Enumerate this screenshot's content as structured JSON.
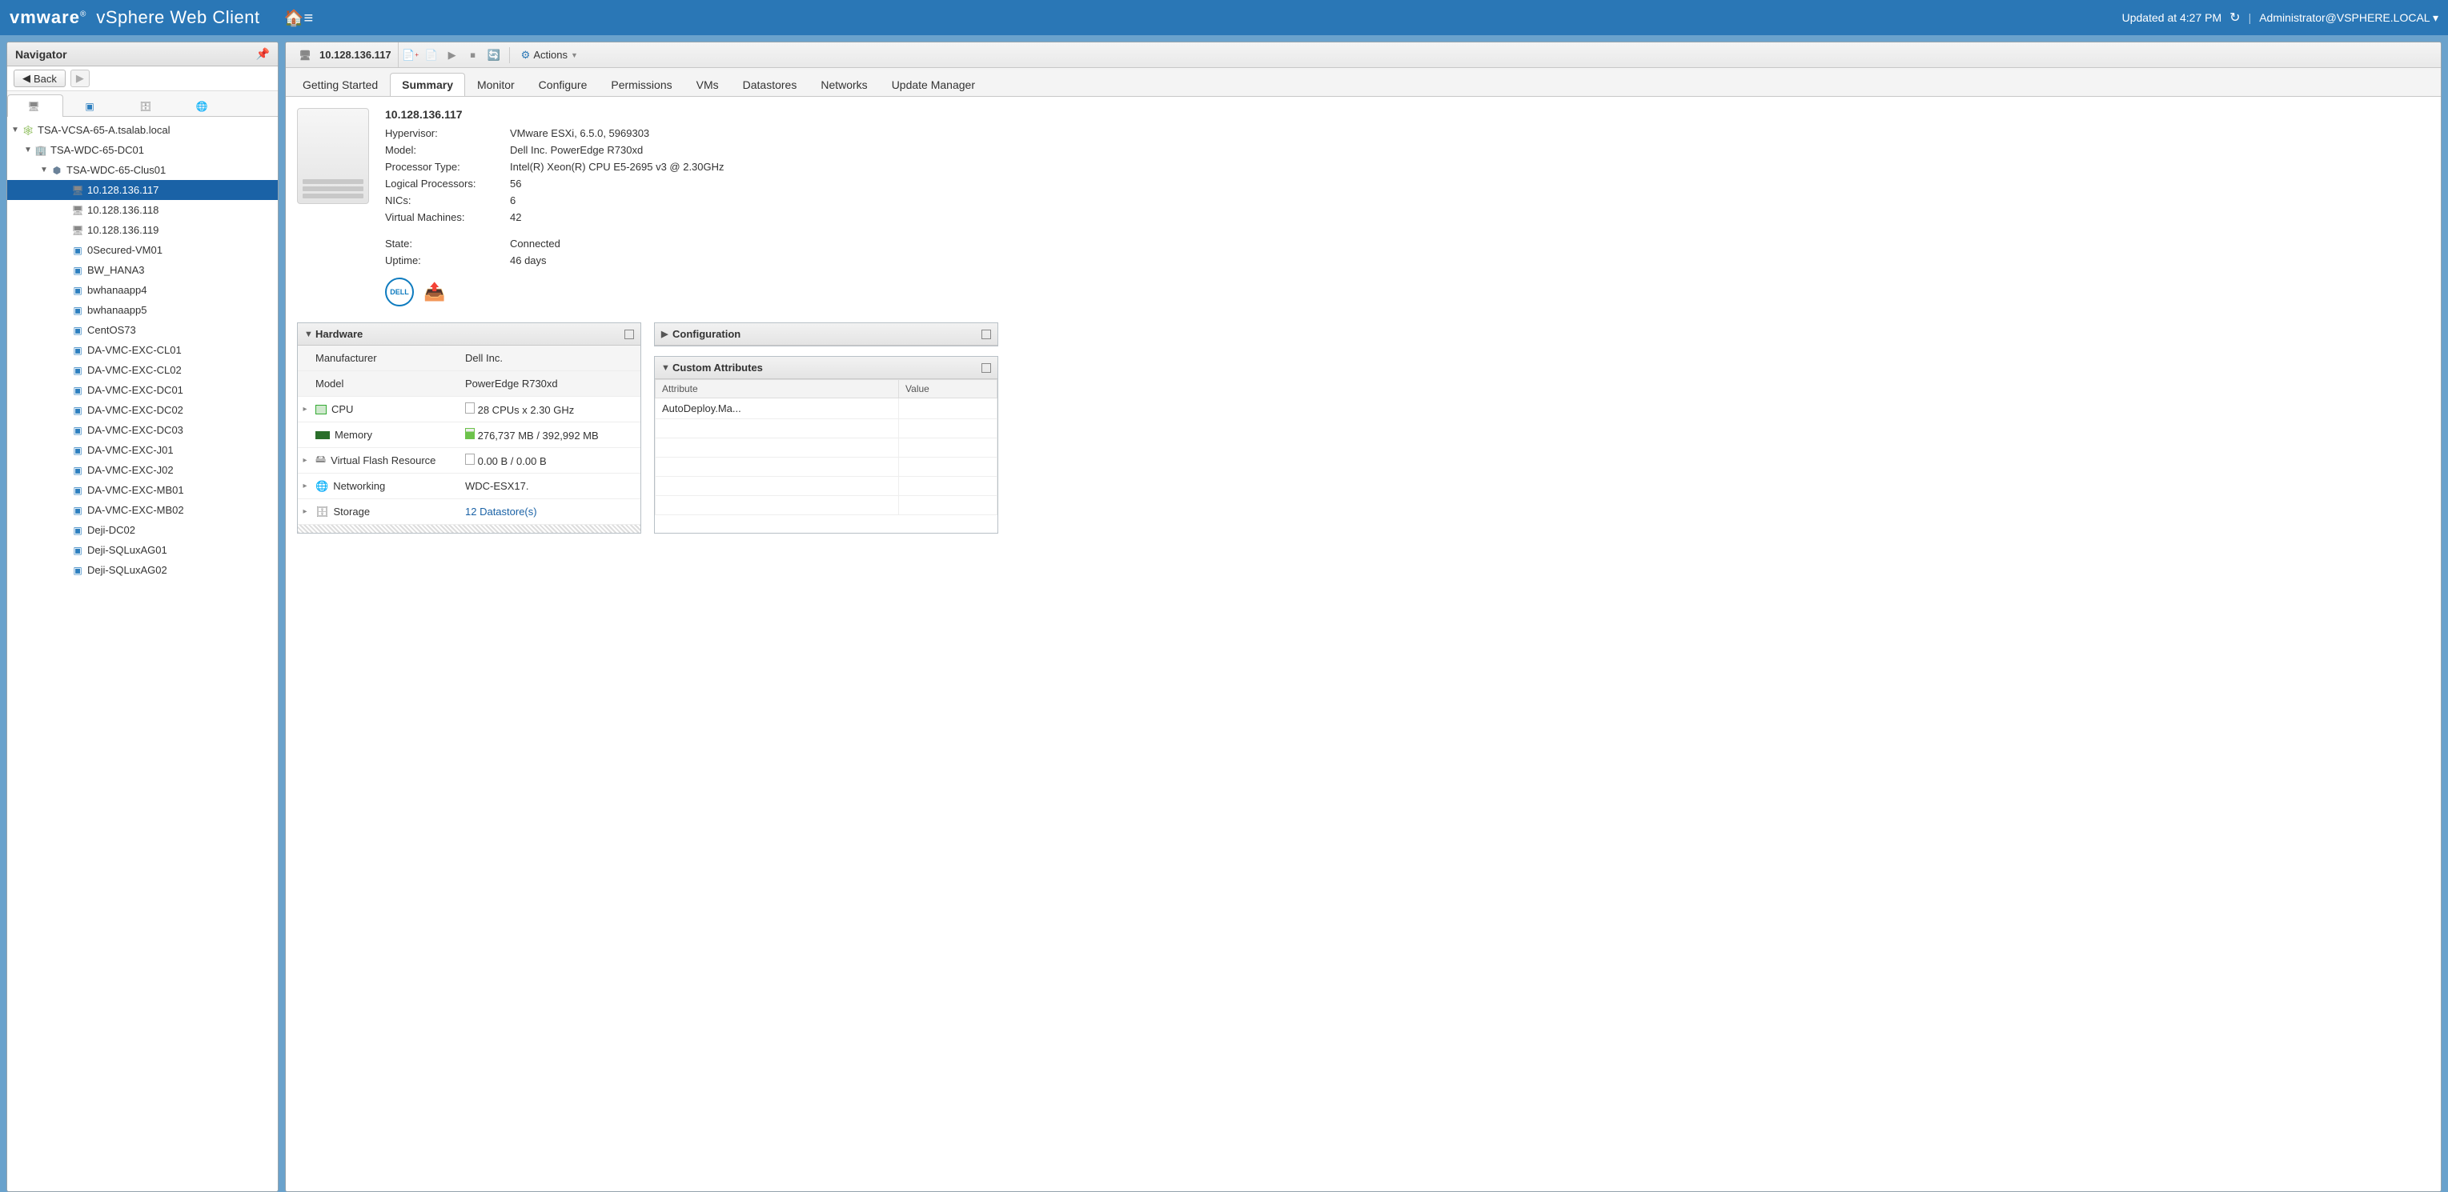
{
  "banner": {
    "brand": "vmware",
    "product": "vSphere Web Client",
    "updated": "Updated at 4:27 PM",
    "user": "Administrator@VSPHERE.LOCAL"
  },
  "navigator": {
    "title": "Navigator",
    "back": "Back",
    "tree": {
      "vcenter": "TSA-VCSA-65-A.tsalab.local",
      "datacenter": "TSA-WDC-65-DC01",
      "cluster": "TSA-WDC-65-Clus01",
      "hosts": [
        "10.128.136.117",
        "10.128.136.118",
        "10.128.136.119"
      ],
      "vms": [
        "0Secured-VM01",
        "BW_HANA3",
        "bwhanaapp4",
        "bwhanaapp5",
        "CentOS73",
        "DA-VMC-EXC-CL01",
        "DA-VMC-EXC-CL02",
        "DA-VMC-EXC-DC01",
        "DA-VMC-EXC-DC02",
        "DA-VMC-EXC-DC03",
        "DA-VMC-EXC-J01",
        "DA-VMC-EXC-J02",
        "DA-VMC-EXC-MB01",
        "DA-VMC-EXC-MB02",
        "Deji-DC02",
        "Deji-SQLuxAG01",
        "Deji-SQLuxAG02"
      ]
    }
  },
  "content": {
    "toolbar": {
      "host": "10.128.136.117",
      "actions": "Actions"
    },
    "tabs": [
      "Getting Started",
      "Summary",
      "Monitor",
      "Configure",
      "Permissions",
      "VMs",
      "Datastores",
      "Networks",
      "Update Manager"
    ],
    "active_tab": 1,
    "summary": {
      "title": "10.128.136.117",
      "rows": [
        {
          "k": "Hypervisor:",
          "v": "VMware ESXi, 6.5.0, 5969303"
        },
        {
          "k": "Model:",
          "v": "Dell Inc. PowerEdge R730xd"
        },
        {
          "k": "Processor Type:",
          "v": "Intel(R) Xeon(R) CPU E5-2695 v3 @ 2.30GHz"
        },
        {
          "k": "Logical Processors:",
          "v": "56"
        },
        {
          "k": "NICs:",
          "v": "6"
        },
        {
          "k": "Virtual Machines:",
          "v": "42"
        }
      ],
      "rows2": [
        {
          "k": "State:",
          "v": "Connected"
        },
        {
          "k": "Uptime:",
          "v": "46 days"
        }
      ],
      "dell": "DELL"
    },
    "hardware": {
      "title": "Hardware",
      "rows": [
        {
          "label": "Manufacturer",
          "value": "Dell Inc.",
          "expand": false,
          "hdr": true,
          "icon": ""
        },
        {
          "label": "Model",
          "value": "PowerEdge R730xd",
          "expand": false,
          "hdr": true,
          "icon": ""
        },
        {
          "label": "CPU",
          "value": "28 CPUs x 2.30 GHz",
          "expand": true,
          "icon": "cpu"
        },
        {
          "label": "Memory",
          "value": "276,737 MB / 392,992 MB",
          "expand": false,
          "icon": "mem"
        },
        {
          "label": "Virtual Flash Resource",
          "value": "0.00 B / 0.00 B",
          "expand": true,
          "icon": "flash"
        },
        {
          "label": "Networking",
          "value": "WDC-ESX17.",
          "expand": true,
          "icon": "net"
        },
        {
          "label": "Storage",
          "value": "12 Datastore(s)",
          "expand": true,
          "icon": "stor",
          "link": true
        }
      ]
    },
    "configuration": {
      "title": "Configuration"
    },
    "custom_attrs": {
      "title": "Custom Attributes",
      "cols": [
        "Attribute",
        "Value"
      ],
      "rows": [
        {
          "attr": "AutoDeploy.Ma...",
          "val": ""
        }
      ]
    }
  }
}
